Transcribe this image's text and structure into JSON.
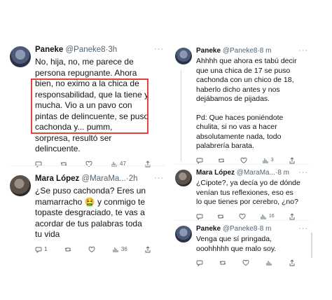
{
  "left": {
    "tweet1": {
      "name": "Paneke",
      "handle": "@Paneke8",
      "time": "3h",
      "lines": [
        "No, hija, no, me parece de",
        "persona repugnante. Ahora",
        "bien, no eximo a la chica de",
        "responsabilidad, que la tiene y",
        "mucha. Vio a un pavo con",
        "pintas de delincuente, se puso",
        "cachonda y... pumm,",
        "sorpresa, resultó ser",
        "delincuente."
      ],
      "views": "47",
      "highlight_color": "#e0453a"
    },
    "tweet2": {
      "name": "Mara López",
      "handle": "@MaraMa...",
      "time": "2h",
      "lines": [
        "¿Se puso cachonda? Eres un",
        "mamarracho 🤮 y conmigo te",
        "topaste desgraciado, te vas a",
        "acordar de tus palabras toda",
        "tu vida"
      ],
      "replies": "1",
      "views": "36"
    }
  },
  "right": {
    "tweet1": {
      "name": "Paneke",
      "handle": "@Paneke8",
      "time": "8 m",
      "para1": [
        "Ahhhh que ahora es tabú decir",
        "que una chica de 17 se puso",
        "cachonda con un chico de 18,",
        "haberlo dicho antes y nos",
        "dejábamos de pijadas."
      ],
      "para2": [
        "Pd: Que haces poniéndote",
        "chulita, si no vas a hacer",
        "absolutamente nada, todo",
        "palabrería barata."
      ],
      "views": "3"
    },
    "tweet2": {
      "name": "Mara López",
      "handle": "@MaraMa...",
      "time": "8 m",
      "lines": [
        "¿Cipote?, ya decía yo de dónde",
        "venían tus reflexiones, eso es",
        "lo que tienes por cerebro, ¿no?"
      ],
      "views": "16"
    },
    "tweet3": {
      "name": "Paneke",
      "handle": "@Paneke8",
      "time": "8 m",
      "lines": [
        "Venga que sí pringada,",
        "ooohhhhh que malo soy."
      ]
    }
  },
  "common": {
    "dot": "·",
    "more": "···"
  }
}
